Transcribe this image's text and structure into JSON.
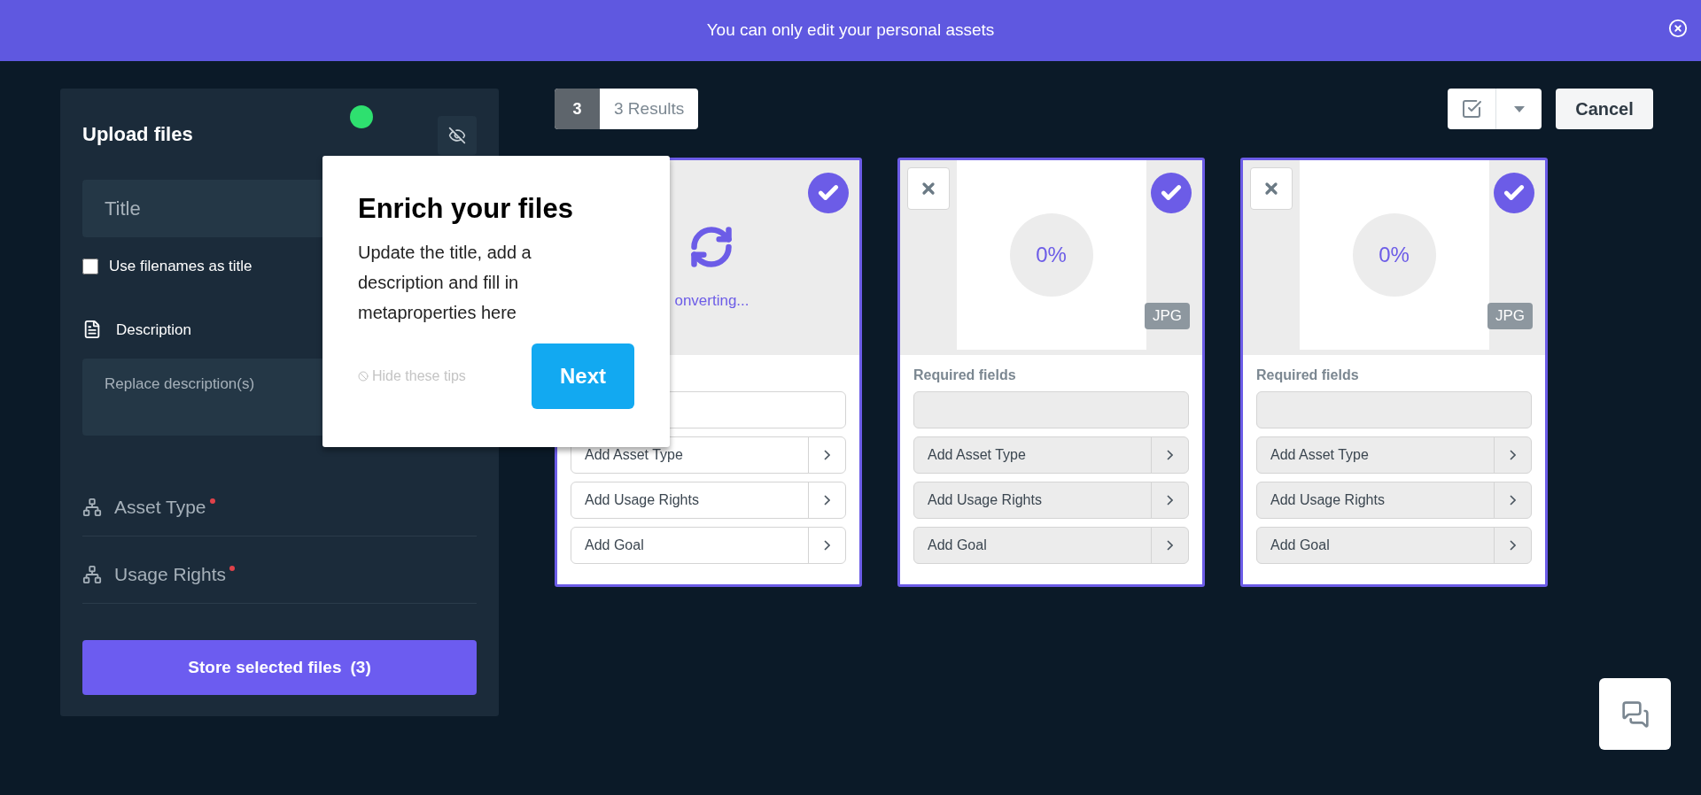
{
  "banner": {
    "message": "You can only edit your personal assets"
  },
  "upload_panel": {
    "title": "Upload files",
    "title_field": {
      "placeholder": "Title"
    },
    "use_filenames": {
      "label": "Use filenames as title",
      "checked": false
    },
    "description": {
      "label": "Description",
      "placeholder": "Replace description(s)"
    },
    "metaproperties": [
      {
        "label": "Asset Type",
        "required": true
      },
      {
        "label": "Usage Rights",
        "required": true
      }
    ],
    "store_button": {
      "label": "Store selected files",
      "count": "(3)"
    }
  },
  "tip": {
    "title": "Enrich your files",
    "body": "Update the title, add a description and fill in metaproperties here",
    "hide_link": "Hide these tips",
    "next_button": "Next"
  },
  "results": {
    "count": "3",
    "label": "3 Results"
  },
  "toolbar": {
    "cancel": "Cancel"
  },
  "cards": [
    {
      "kind": "converting",
      "selected": true,
      "status": "onverting...",
      "fields": [
        "Add Asset Type",
        "Add Usage Rights",
        "Add Goal"
      ]
    },
    {
      "kind": "upload",
      "selected": true,
      "progress": "0%",
      "file_type": "JPG",
      "section_label": "Required fields",
      "fields": [
        "Add Asset Type",
        "Add Usage Rights",
        "Add Goal"
      ]
    },
    {
      "kind": "upload",
      "selected": true,
      "progress": "0%",
      "file_type": "JPG",
      "section_label": "Required fields",
      "fields": [
        "Add Asset Type",
        "Add Usage Rights",
        "Add Goal"
      ]
    }
  ]
}
